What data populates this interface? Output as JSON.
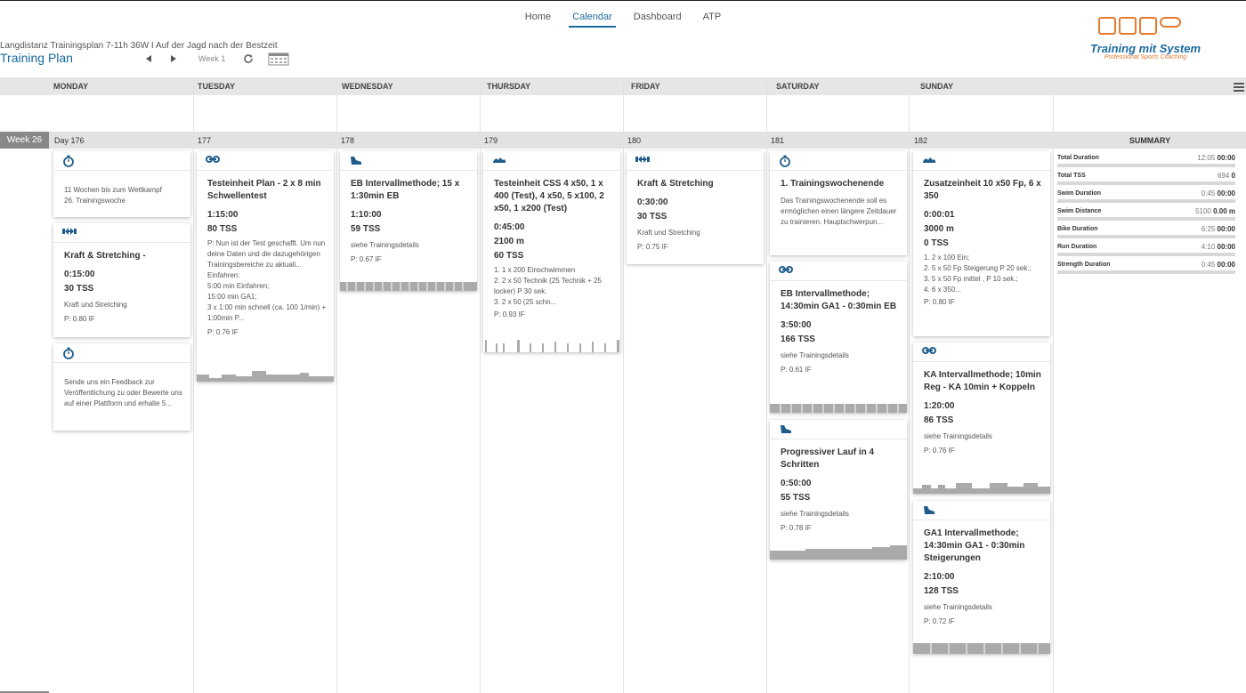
{
  "nav": {
    "items": [
      "Home",
      "Calendar",
      "Dashboard",
      "ATP"
    ],
    "active": "Calendar"
  },
  "plan": {
    "subtitle": "Langdistanz Trainingsplan 7-11h 36W I Auf der Jagd nach der Bestzeit",
    "title": "Training Plan",
    "week_label": "Week 1"
  },
  "logo": {
    "text": "Training mit System",
    "sub": "Professional Sports Coaching"
  },
  "days": [
    "MONDAY",
    "TUESDAY",
    "WEDNESDAY",
    "THURSDAY",
    "FRIDAY",
    "SATURDAY",
    "SUNDAY"
  ],
  "week": {
    "label": "Week 26",
    "day_numbers": [
      "Day 176",
      "177",
      "178",
      "179",
      "180",
      "181",
      "182"
    ],
    "summary_label": "SUMMARY"
  },
  "colors": {
    "accent": "#1a6aa0",
    "icon": "#1f5d8c",
    "logo_orange": "#e67a2e"
  },
  "cards": {
    "mon1": {
      "icon": "stopwatch-icon",
      "note": "11 Wochen bis zum Wettkampf\n26. Trainingswoche"
    },
    "mon2": {
      "icon": "strength-icon",
      "title": "Kraft & Stretching -",
      "duration": "0:15:00",
      "tss": "30 TSS",
      "desc": "Kraft und Stretching",
      "if": "P: 0.80 IF"
    },
    "mon3": {
      "icon": "stopwatch-icon",
      "note": "Sende uns ein Feedback zur Veröffentlichung zu oder Bewerte uns auf einer Plattform und erhalte 5..."
    },
    "tue1": {
      "icon": "bike-icon",
      "title": "Testeinheit Plan - 2 x 8 min Schwellentest",
      "duration": "1:15:00",
      "tss": "80 TSS",
      "desc": "P: Nun ist der Test geschafft. Um nun deine Daten und die dazugehörigen Trainingsbereiche zu aktuali...\nEinfahren:\n5:00 min Einfahren;\n15:00 min GA1;\n3 x 1:00 min schnell (ca. 100 1/min) + 1:00min P...",
      "if": "P: 0.76 IF"
    },
    "wed1": {
      "icon": "run-icon",
      "title": "EB Intervallmethode; 15 x 1:30min EB",
      "duration": "1:10:00",
      "tss": "59 TSS",
      "desc": "siehe Trainingsdetails",
      "if": "P: 0.67 IF"
    },
    "thu1": {
      "icon": "swim-icon",
      "title": "Testeinheit CSS 4 x50, 1 x 400 (Test), 4 x50, 5 x100, 2 x50, 1 x200 (Test)",
      "duration": "0:45:00",
      "distance": "2100 m",
      "tss": "60 TSS",
      "desc": "1. 1 x 200 Einschwimmen\n2. 2 x 50 Technik (25 Technik + 25 locker) P 30 sek.\n3. 2 x 50 (25 schn...",
      "if": "P: 0.93 IF"
    },
    "fri1": {
      "icon": "strength-icon",
      "title": "Kraft & Stretching",
      "duration": "0:30:00",
      "tss": "30 TSS",
      "desc": "Kraft und Stretching",
      "if": "P: 0.75 IF"
    },
    "sat1": {
      "icon": "stopwatch-icon",
      "title": "1. Trainingswochenende",
      "note": "Das Trainingswochenende soll es ermöglichen einen längere Zeitdauer zu trainieren. Hauptschwerpun..."
    },
    "sat2": {
      "icon": "bike-icon",
      "title": "EB Intervallmethode; 14:30min GA1 - 0:30min EB",
      "duration": "3:50:00",
      "tss": "166 TSS",
      "desc": "siehe Trainingsdetails",
      "if": "P: 0.61 IF"
    },
    "sat3": {
      "icon": "run-icon",
      "title": "Progressiver Lauf in 4 Schritten",
      "duration": "0:50:00",
      "tss": "55 TSS",
      "desc": "siehe Trainingsdetails",
      "if": "P: 0.78 IF"
    },
    "sun1": {
      "icon": "swim-icon",
      "title": "Zusatzeinheit 10 x50 Fp, 6 x 350",
      "duration": "0:00:01",
      "distance": "3000 m",
      "tss": "0 TSS",
      "desc": "1. 2 x 100 Ein;\n2. 5 x 50 Fp Steigerung P 20 sek.;\n3. 5 x 50 Fp mittel , P 10 sek.;\n4. 6 x 350...",
      "if": "P: 0.80 IF"
    },
    "sun2": {
      "icon": "bike-icon",
      "title": "KA Intervallmethode; 10min Reg - KA 10min + Koppeln",
      "duration": "1:20:00",
      "tss": "86 TSS",
      "desc": "siehe Trainingsdetails",
      "if": "P: 0.76 IF"
    },
    "sun3": {
      "icon": "run-icon",
      "title": "GA1 Intervallmethode; 14:30min GA1 - 0:30min Steigerungen",
      "duration": "2:10:00",
      "tss": "128 TSS",
      "desc": "siehe Trainingsdetails",
      "if": "P: 0.72 IF"
    }
  },
  "summary": [
    {
      "label": "Total Duration",
      "value": "12:05",
      "bold": "00:00"
    },
    {
      "label": "Total TSS",
      "value": "694",
      "bold": "0"
    },
    {
      "label": "Swim Duration",
      "value": "0:45",
      "bold": "00:00"
    },
    {
      "label": "Swim Distance",
      "value": "5100",
      "bold": "0.00 m"
    },
    {
      "label": "Bike Duration",
      "value": "6:25",
      "bold": "00:00"
    },
    {
      "label": "Run Duration",
      "value": "4:10",
      "bold": "00:00"
    },
    {
      "label": "Strength Duration",
      "value": "0:45",
      "bold": "00:00"
    }
  ]
}
